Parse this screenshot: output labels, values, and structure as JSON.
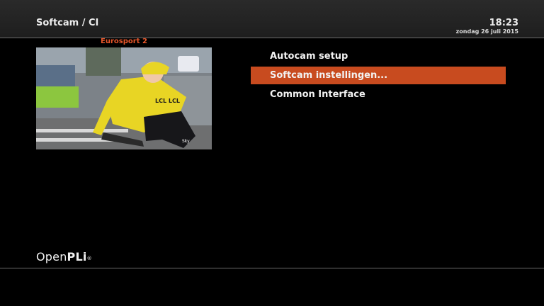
{
  "header": {
    "title": "Softcam / CI",
    "time": "18:23",
    "date": "zondag 26 juli 2015"
  },
  "preview": {
    "channel": "Eurosport 2",
    "jersey_text": "LCL LCL",
    "sponsor_text": "Sky"
  },
  "menu": {
    "items": [
      {
        "label": "Autocam setup",
        "selected": false
      },
      {
        "label": "Softcam instellingen...",
        "selected": true
      },
      {
        "label": "Common Interface",
        "selected": false
      }
    ]
  },
  "logo": {
    "text_regular": "Open",
    "text_bold": "PLi",
    "mark": "®"
  },
  "colors": {
    "accent": "#c84b1f",
    "channel_name": "#e8562a",
    "background": "#000000",
    "header": "#242424"
  }
}
